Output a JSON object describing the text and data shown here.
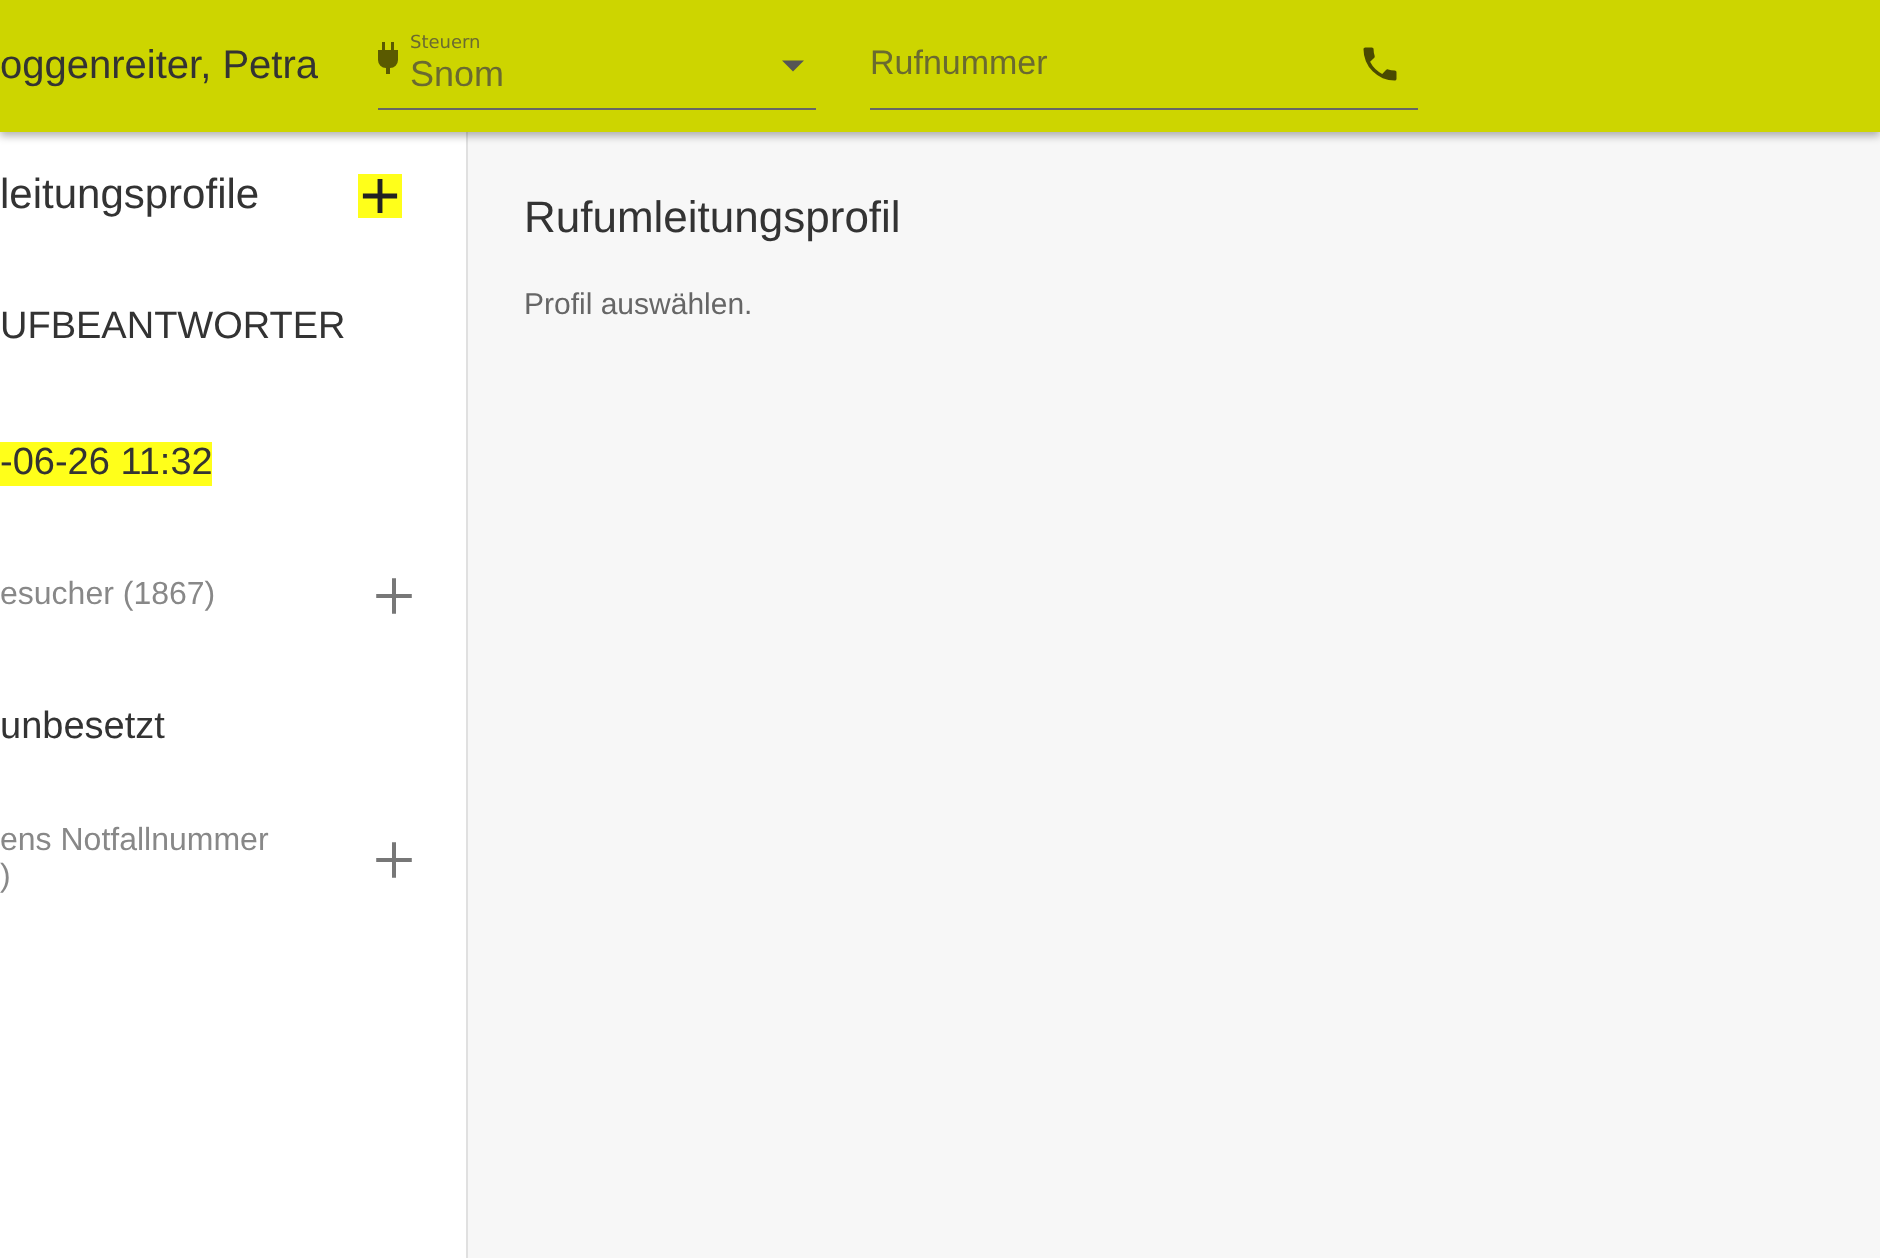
{
  "header": {
    "user": "oggenreiter, Petra",
    "device_field": {
      "label": "Steuern",
      "value": "Snom"
    },
    "number_field": {
      "placeholder": "Rufnummer"
    }
  },
  "sidebar": {
    "title": "leitungsprofile",
    "title_add_highlighted": true,
    "items": [
      {
        "kind": "profile",
        "label": "UFBEANTWORTER",
        "highlighted": false
      },
      {
        "kind": "profile",
        "label": "-06-26 11:32",
        "highlighted": true
      },
      {
        "kind": "group",
        "label": "esucher (1867)",
        "highlighted": false
      },
      {
        "kind": "profile",
        "label": "unbesetzt",
        "highlighted": false
      },
      {
        "kind": "group",
        "label": "ens Notfallnummer\n)",
        "highlighted": false
      }
    ]
  },
  "main": {
    "title": "Rufumleitungsprofil",
    "hint": "Profil auswählen."
  }
}
